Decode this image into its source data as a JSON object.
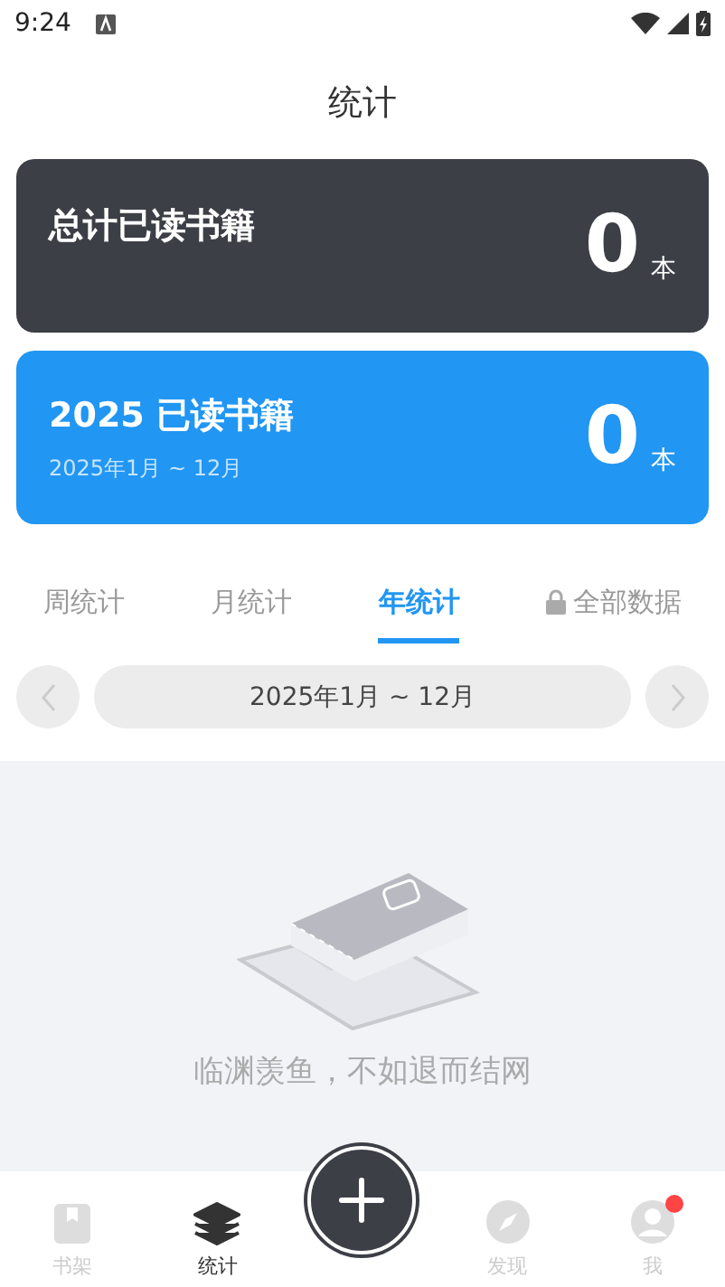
{
  "status_bar": {
    "time": "9:24"
  },
  "header": {
    "title": "统计"
  },
  "total_card": {
    "label": "总计已读书籍",
    "count": "0",
    "unit": "本"
  },
  "year_card": {
    "label": "2025 已读书籍",
    "range": "2025年1月 ~ 12月",
    "count": "0",
    "unit": "本"
  },
  "tabs": [
    {
      "label": "周统计",
      "selected": false,
      "locked": false
    },
    {
      "label": "月统计",
      "selected": false,
      "locked": false
    },
    {
      "label": "年统计",
      "selected": true,
      "locked": false
    },
    {
      "label": "全部数据",
      "selected": false,
      "locked": true
    }
  ],
  "period": {
    "label": "2025年1月 ~ 12月"
  },
  "empty_state": {
    "message": "临渊羡鱼，不如退而结网"
  },
  "nav": [
    {
      "label": "书架",
      "selected": false,
      "kind": "book",
      "badge": false
    },
    {
      "label": "统计",
      "selected": true,
      "kind": "layers",
      "badge": false
    },
    {
      "label": "发现",
      "selected": false,
      "kind": "compass",
      "badge": false
    },
    {
      "label": "我",
      "selected": false,
      "kind": "user",
      "badge": true
    }
  ]
}
